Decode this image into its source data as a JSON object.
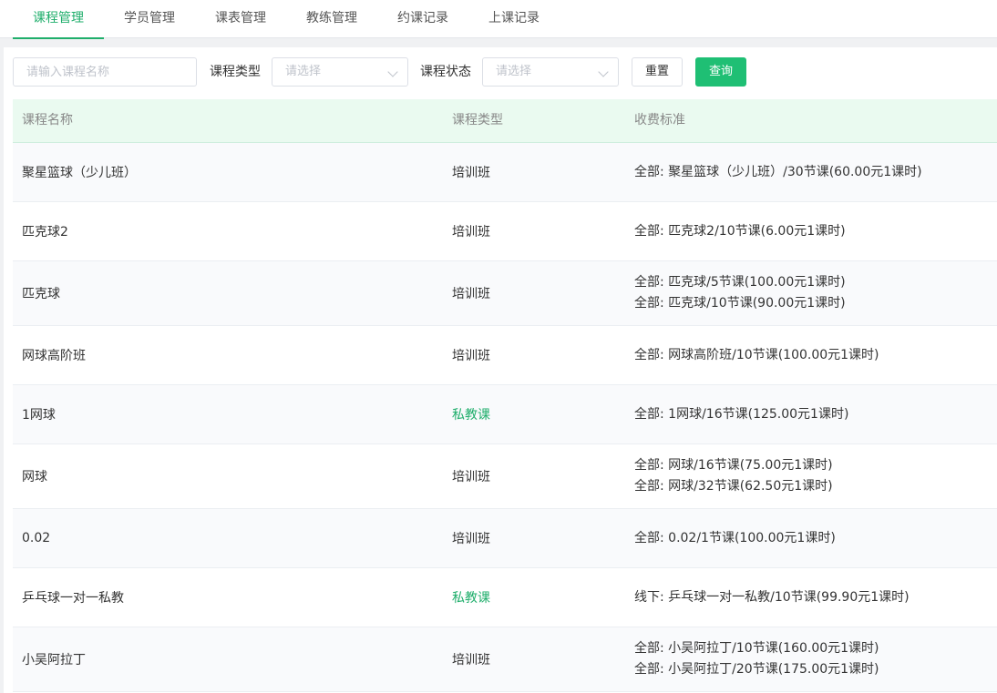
{
  "tabs": [
    {
      "label": "课程管理",
      "active": true
    },
    {
      "label": "学员管理",
      "active": false
    },
    {
      "label": "课表管理",
      "active": false
    },
    {
      "label": "教练管理",
      "active": false
    },
    {
      "label": "约课记录",
      "active": false
    },
    {
      "label": "上课记录",
      "active": false
    }
  ],
  "filter": {
    "name_placeholder": "请输入课程名称",
    "type_label": "课程类型",
    "type_placeholder": "请选择",
    "status_label": "课程状态",
    "status_placeholder": "请选择",
    "reset_label": "重置",
    "query_label": "查询"
  },
  "table": {
    "headers": [
      "课程名称",
      "课程类型",
      "收费标准"
    ],
    "rows": [
      {
        "name": "聚星篮球（少儿班）",
        "type": "培训班",
        "fees": [
          "全部:  聚星篮球（少儿班）/30节课(60.00元1课时)"
        ]
      },
      {
        "name": "匹克球2",
        "type": "培训班",
        "fees": [
          "全部:  匹克球2/10节课(6.00元1课时)"
        ]
      },
      {
        "name": "匹克球",
        "type": "培训班",
        "fees": [
          "全部:  匹克球/5节课(100.00元1课时)",
          "全部:  匹克球/10节课(90.00元1课时)"
        ]
      },
      {
        "name": "网球高阶班",
        "type": "培训班",
        "fees": [
          "全部:  网球高阶班/10节课(100.00元1课时)"
        ]
      },
      {
        "name": "1网球",
        "type": "私教课",
        "fees": [
          "全部:  1网球/16节课(125.00元1课时)"
        ]
      },
      {
        "name": "网球",
        "type": "培训班",
        "fees": [
          "全部:  网球/16节课(75.00元1课时)",
          "全部:  网球/32节课(62.50元1课时)"
        ]
      },
      {
        "name": "0.02",
        "type": "培训班",
        "fees": [
          "全部:  0.02/1节课(100.00元1课时)"
        ]
      },
      {
        "name": "乒乓球一对一私教",
        "type": "私教课",
        "fees": [
          "线下:  乒乓球一对一私教/10节课(99.90元1课时)"
        ]
      },
      {
        "name": "小吴阿拉丁",
        "type": "培训班",
        "fees": [
          "全部:  小吴阿拉丁/10节课(160.00元1课时)",
          "全部:  小吴阿拉丁/20节课(175.00元1课时)"
        ]
      }
    ]
  },
  "colors": {
    "accent": "#1fae6b",
    "header_bg": "#eafaf0",
    "query_button": "#1fbf74"
  }
}
